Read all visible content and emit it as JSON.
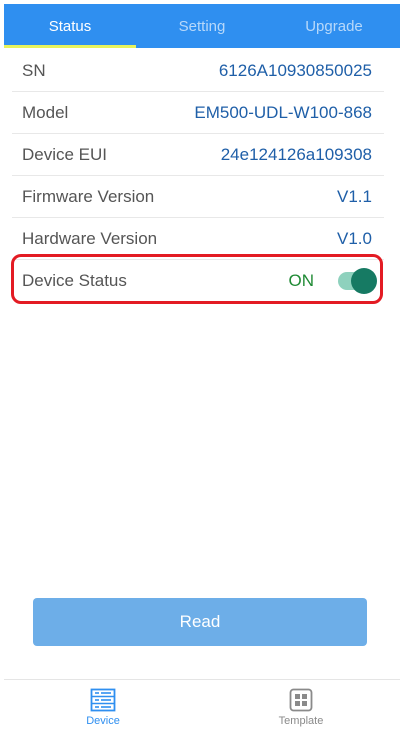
{
  "tabs": [
    {
      "label": "Status"
    },
    {
      "label": "Setting"
    },
    {
      "label": "Upgrade"
    }
  ],
  "info": {
    "sn": {
      "label": "SN",
      "value": "6126A10930850025"
    },
    "model": {
      "label": "Model",
      "value": "EM500-UDL-W100-868"
    },
    "device_eui": {
      "label": "Device EUI",
      "value": "24e124126a109308"
    },
    "firmware": {
      "label": "Firmware Version",
      "value": "V1.1"
    },
    "hardware": {
      "label": "Hardware Version",
      "value": "V1.0"
    },
    "device_status": {
      "label": "Device Status",
      "value": "ON",
      "toggle_on": true
    }
  },
  "read_button": {
    "label": "Read"
  },
  "bottom_nav": [
    {
      "label": "Device",
      "icon": "device-icon"
    },
    {
      "label": "Template",
      "icon": "template-icon"
    }
  ],
  "colors": {
    "accent": "#2f8ff0",
    "tab_indicator": "#e8f35c",
    "value_text": "#1f5fa8",
    "status_on": "#1f8a34",
    "toggle_track": "#8ed1bd",
    "toggle_knob": "#167a63",
    "highlight": "#e31b23",
    "button": "#6daee8"
  }
}
